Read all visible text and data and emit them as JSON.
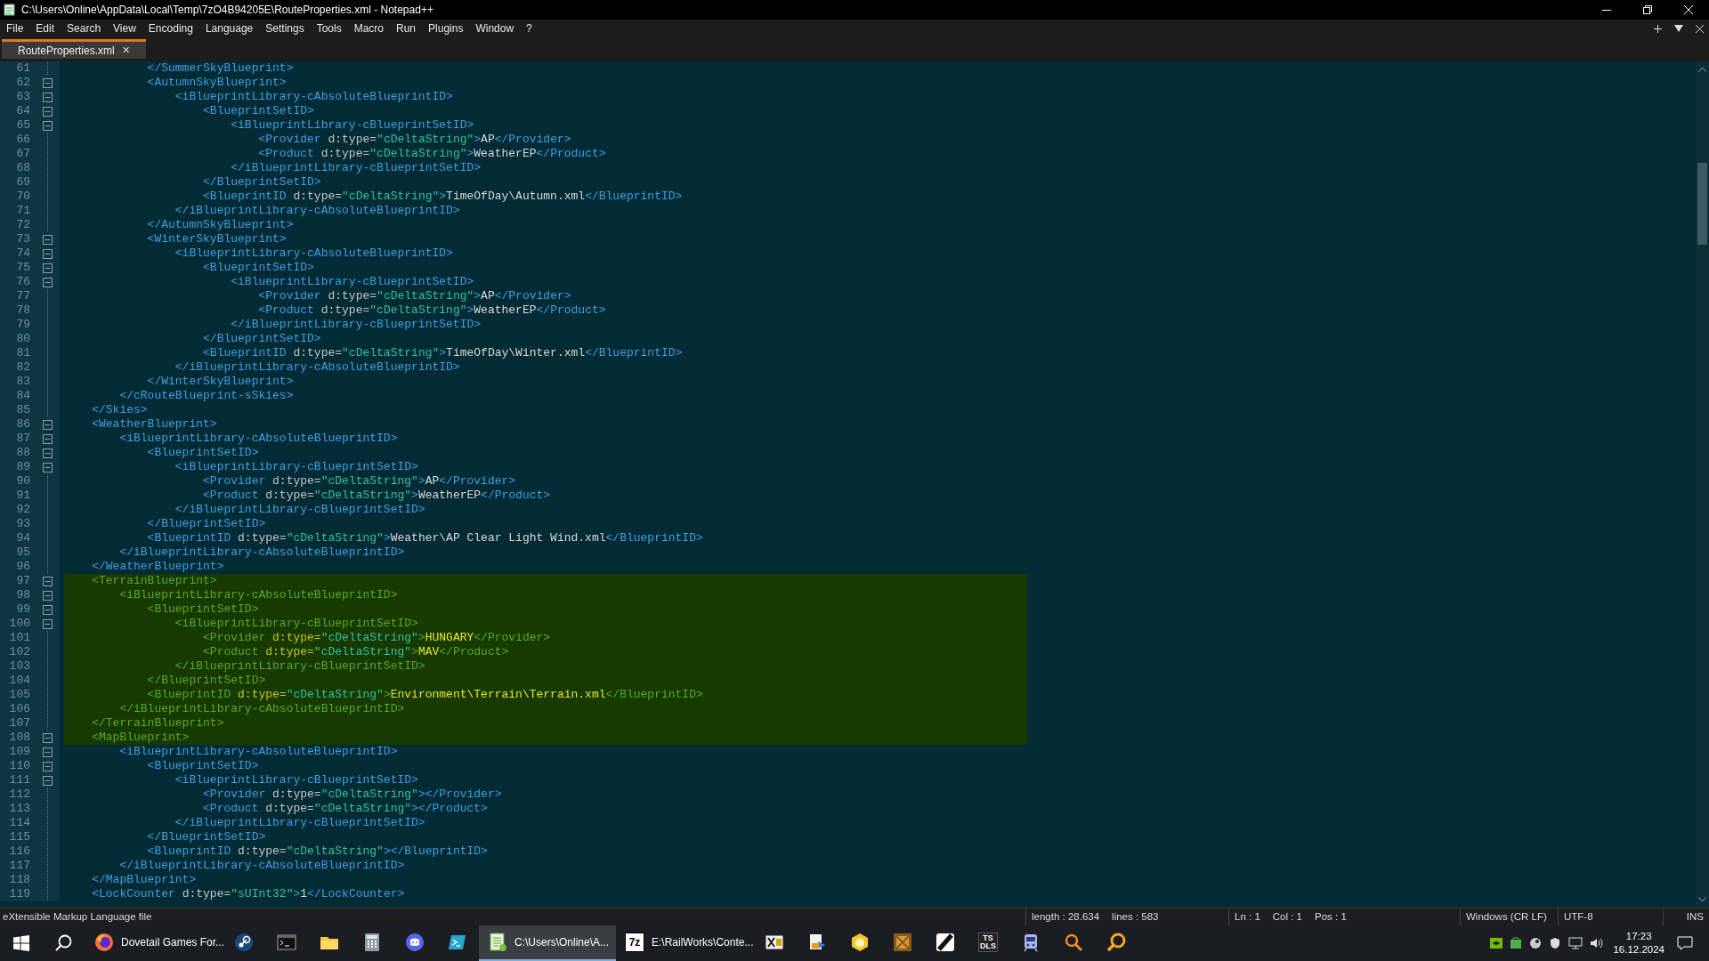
{
  "window": {
    "title": "C:\\Users\\Online\\AppData\\Local\\Temp\\7zO4B94205E\\RouteProperties.xml - Notepad++"
  },
  "menu": [
    "File",
    "Edit",
    "Search",
    "View",
    "Encoding",
    "Language",
    "Settings",
    "Tools",
    "Macro",
    "Run",
    "Plugins",
    "Window",
    "?"
  ],
  "tabs": [
    {
      "label": "RouteProperties.xml",
      "close": "✕",
      "selected": true
    }
  ],
  "editor": {
    "lines": [
      {
        "number": "61",
        "fold": false,
        "highlighted": false,
        "tokens": [
          {
            "kind": "tag",
            "text": "            </SummerSkyBlueprint>"
          }
        ]
      },
      {
        "number": "62",
        "fold": true,
        "highlighted": false,
        "tokens": [
          {
            "kind": "tag",
            "text": "            <AutumnSkyBlueprint>"
          }
        ]
      },
      {
        "number": "63",
        "fold": true,
        "highlighted": false,
        "tokens": [
          {
            "kind": "tag",
            "text": "                <iBlueprintLibrary-cAbsoluteBlueprintID>"
          }
        ]
      },
      {
        "number": "64",
        "fold": true,
        "highlighted": false,
        "tokens": [
          {
            "kind": "tag",
            "text": "                    <BlueprintSetID>"
          }
        ]
      },
      {
        "number": "65",
        "fold": true,
        "highlighted": false,
        "tokens": [
          {
            "kind": "tag",
            "text": "                        <iBlueprintLibrary-cBlueprintSetID>"
          }
        ]
      },
      {
        "number": "66",
        "fold": false,
        "highlighted": false,
        "tokens": [
          {
            "kind": "tag",
            "text": "                            <Provider"
          },
          {
            "kind": "attr",
            "text": " d:type="
          },
          {
            "kind": "value",
            "text": "\"cDeltaString\""
          },
          {
            "kind": "tag",
            "text": ">"
          },
          {
            "kind": "text",
            "text": "AP"
          },
          {
            "kind": "tag",
            "text": "</Provider>"
          }
        ]
      },
      {
        "number": "67",
        "fold": false,
        "highlighted": false,
        "tokens": [
          {
            "kind": "tag",
            "text": "                            <Product"
          },
          {
            "kind": "attr",
            "text": " d:type="
          },
          {
            "kind": "value",
            "text": "\"cDeltaString\""
          },
          {
            "kind": "tag",
            "text": ">"
          },
          {
            "kind": "text",
            "text": "WeatherEP"
          },
          {
            "kind": "tag",
            "text": "</Product>"
          }
        ]
      },
      {
        "number": "68",
        "fold": false,
        "highlighted": false,
        "tokens": [
          {
            "kind": "tag",
            "text": "                        </iBlueprintLibrary-cBlueprintSetID>"
          }
        ]
      },
      {
        "number": "69",
        "fold": false,
        "highlighted": false,
        "tokens": [
          {
            "kind": "tag",
            "text": "                    </BlueprintSetID>"
          }
        ]
      },
      {
        "number": "70",
        "fold": false,
        "highlighted": false,
        "tokens": [
          {
            "kind": "tag",
            "text": "                    <BlueprintID"
          },
          {
            "kind": "attr",
            "text": " d:type="
          },
          {
            "kind": "value",
            "text": "\"cDeltaString\""
          },
          {
            "kind": "tag",
            "text": ">"
          },
          {
            "kind": "text",
            "text": "TimeOfDay\\Autumn.xml"
          },
          {
            "kind": "tag",
            "text": "</BlueprintID>"
          }
        ]
      },
      {
        "number": "71",
        "fold": false,
        "highlighted": false,
        "tokens": [
          {
            "kind": "tag",
            "text": "                </iBlueprintLibrary-cAbsoluteBlueprintID>"
          }
        ]
      },
      {
        "number": "72",
        "fold": false,
        "highlighted": false,
        "tokens": [
          {
            "kind": "tag",
            "text": "            </AutumnSkyBlueprint>"
          }
        ]
      },
      {
        "number": "73",
        "fold": true,
        "highlighted": false,
        "tokens": [
          {
            "kind": "tag",
            "text": "            <WinterSkyBlueprint>"
          }
        ]
      },
      {
        "number": "74",
        "fold": true,
        "highlighted": false,
        "tokens": [
          {
            "kind": "tag",
            "text": "                <iBlueprintLibrary-cAbsoluteBlueprintID>"
          }
        ]
      },
      {
        "number": "75",
        "fold": true,
        "highlighted": false,
        "tokens": [
          {
            "kind": "tag",
            "text": "                    <BlueprintSetID>"
          }
        ]
      },
      {
        "number": "76",
        "fold": true,
        "highlighted": false,
        "tokens": [
          {
            "kind": "tag",
            "text": "                        <iBlueprintLibrary-cBlueprintSetID>"
          }
        ]
      },
      {
        "number": "77",
        "fold": false,
        "highlighted": false,
        "tokens": [
          {
            "kind": "tag",
            "text": "                            <Provider"
          },
          {
            "kind": "attr",
            "text": " d:type="
          },
          {
            "kind": "value",
            "text": "\"cDeltaString\""
          },
          {
            "kind": "tag",
            "text": ">"
          },
          {
            "kind": "text",
            "text": "AP"
          },
          {
            "kind": "tag",
            "text": "</Provider>"
          }
        ]
      },
      {
        "number": "78",
        "fold": false,
        "highlighted": false,
        "tokens": [
          {
            "kind": "tag",
            "text": "                            <Product"
          },
          {
            "kind": "attr",
            "text": " d:type="
          },
          {
            "kind": "value",
            "text": "\"cDeltaString\""
          },
          {
            "kind": "tag",
            "text": ">"
          },
          {
            "kind": "text",
            "text": "WeatherEP"
          },
          {
            "kind": "tag",
            "text": "</Product>"
          }
        ]
      },
      {
        "number": "79",
        "fold": false,
        "highlighted": false,
        "tokens": [
          {
            "kind": "tag",
            "text": "                        </iBlueprintLibrary-cBlueprintSetID>"
          }
        ]
      },
      {
        "number": "80",
        "fold": false,
        "highlighted": false,
        "tokens": [
          {
            "kind": "tag",
            "text": "                    </BlueprintSetID>"
          }
        ]
      },
      {
        "number": "81",
        "fold": false,
        "highlighted": false,
        "tokens": [
          {
            "kind": "tag",
            "text": "                    <BlueprintID"
          },
          {
            "kind": "attr",
            "text": " d:type="
          },
          {
            "kind": "value",
            "text": "\"cDeltaString\""
          },
          {
            "kind": "tag",
            "text": ">"
          },
          {
            "kind": "text",
            "text": "TimeOfDay\\Winter.xml"
          },
          {
            "kind": "tag",
            "text": "</BlueprintID>"
          }
        ]
      },
      {
        "number": "82",
        "fold": false,
        "highlighted": false,
        "tokens": [
          {
            "kind": "tag",
            "text": "                </iBlueprintLibrary-cAbsoluteBlueprintID>"
          }
        ]
      },
      {
        "number": "83",
        "fold": false,
        "highlighted": false,
        "tokens": [
          {
            "kind": "tag",
            "text": "            </WinterSkyBlueprint>"
          }
        ]
      },
      {
        "number": "84",
        "fold": false,
        "highlighted": false,
        "tokens": [
          {
            "kind": "tag",
            "text": "        </cRouteBlueprint-sSkies>"
          }
        ]
      },
      {
        "number": "85",
        "fold": false,
        "highlighted": false,
        "tokens": [
          {
            "kind": "tag",
            "text": "    </Skies>"
          }
        ]
      },
      {
        "number": "86",
        "fold": true,
        "highlighted": false,
        "tokens": [
          {
            "kind": "tag",
            "text": "    <WeatherBlueprint>"
          }
        ]
      },
      {
        "number": "87",
        "fold": true,
        "highlighted": false,
        "tokens": [
          {
            "kind": "tag",
            "text": "        <iBlueprintLibrary-cAbsoluteBlueprintID>"
          }
        ]
      },
      {
        "number": "88",
        "fold": true,
        "highlighted": false,
        "tokens": [
          {
            "kind": "tag",
            "text": "            <BlueprintSetID>"
          }
        ]
      },
      {
        "number": "89",
        "fold": true,
        "highlighted": false,
        "tokens": [
          {
            "kind": "tag",
            "text": "                <iBlueprintLibrary-cBlueprintSetID>"
          }
        ]
      },
      {
        "number": "90",
        "fold": false,
        "highlighted": false,
        "tokens": [
          {
            "kind": "tag",
            "text": "                    <Provider"
          },
          {
            "kind": "attr",
            "text": " d:type="
          },
          {
            "kind": "value",
            "text": "\"cDeltaString\""
          },
          {
            "kind": "tag",
            "text": ">"
          },
          {
            "kind": "text",
            "text": "AP"
          },
          {
            "kind": "tag",
            "text": "</Provider>"
          }
        ]
      },
      {
        "number": "91",
        "fold": false,
        "highlighted": false,
        "tokens": [
          {
            "kind": "tag",
            "text": "                    <Product"
          },
          {
            "kind": "attr",
            "text": " d:type="
          },
          {
            "kind": "value",
            "text": "\"cDeltaString\""
          },
          {
            "kind": "tag",
            "text": ">"
          },
          {
            "kind": "text",
            "text": "WeatherEP"
          },
          {
            "kind": "tag",
            "text": "</Product>"
          }
        ]
      },
      {
        "number": "92",
        "fold": false,
        "highlighted": false,
        "tokens": [
          {
            "kind": "tag",
            "text": "                </iBlueprintLibrary-cBlueprintSetID>"
          }
        ]
      },
      {
        "number": "93",
        "fold": false,
        "highlighted": false,
        "tokens": [
          {
            "kind": "tag",
            "text": "            </BlueprintSetID>"
          }
        ]
      },
      {
        "number": "94",
        "fold": false,
        "highlighted": false,
        "tokens": [
          {
            "kind": "tag",
            "text": "            <BlueprintID"
          },
          {
            "kind": "attr",
            "text": " d:type="
          },
          {
            "kind": "value",
            "text": "\"cDeltaString\""
          },
          {
            "kind": "tag",
            "text": ">"
          },
          {
            "kind": "text",
            "text": "Weather\\AP Clear Light Wind.xml"
          },
          {
            "kind": "tag",
            "text": "</BlueprintID>"
          }
        ]
      },
      {
        "number": "95",
        "fold": false,
        "highlighted": false,
        "tokens": [
          {
            "kind": "tag",
            "text": "        </iBlueprintLibrary-cAbsoluteBlueprintID>"
          }
        ]
      },
      {
        "number": "96",
        "fold": false,
        "highlighted": false,
        "tokens": [
          {
            "kind": "tag",
            "text": "    </WeatherBlueprint>"
          }
        ]
      },
      {
        "number": "97",
        "fold": true,
        "highlighted": true,
        "tokens": [
          {
            "kind": "tag",
            "text": "    <TerrainBlueprint>"
          }
        ]
      },
      {
        "number": "98",
        "fold": true,
        "highlighted": true,
        "tokens": [
          {
            "kind": "tag",
            "text": "        <iBlueprintLibrary-cAbsoluteBlueprintID>"
          }
        ]
      },
      {
        "number": "99",
        "fold": true,
        "highlighted": true,
        "tokens": [
          {
            "kind": "tag",
            "text": "            <BlueprintSetID>"
          }
        ]
      },
      {
        "number": "100",
        "fold": true,
        "highlighted": true,
        "tokens": [
          {
            "kind": "tag",
            "text": "                <iBlueprintLibrary-cBlueprintSetID>"
          }
        ]
      },
      {
        "number": "101",
        "fold": false,
        "highlighted": true,
        "tokens": [
          {
            "kind": "tag",
            "text": "                    <Provider"
          },
          {
            "kind": "attr",
            "text": " d:type="
          },
          {
            "kind": "value",
            "text": "\"cDeltaString\""
          },
          {
            "kind": "tag",
            "text": ">"
          },
          {
            "kind": "text",
            "text": "HUNGARY"
          },
          {
            "kind": "tag",
            "text": "</Provider>"
          }
        ]
      },
      {
        "number": "102",
        "fold": false,
        "highlighted": true,
        "tokens": [
          {
            "kind": "tag",
            "text": "                    <Product"
          },
          {
            "kind": "attr",
            "text": " d:type="
          },
          {
            "kind": "value",
            "text": "\"cDeltaString\""
          },
          {
            "kind": "tag",
            "text": ">"
          },
          {
            "kind": "text",
            "text": "MAV"
          },
          {
            "kind": "tag",
            "text": "</Product>"
          }
        ]
      },
      {
        "number": "103",
        "fold": false,
        "highlighted": true,
        "tokens": [
          {
            "kind": "tag",
            "text": "                </iBlueprintLibrary-cBlueprintSetID>"
          }
        ]
      },
      {
        "number": "104",
        "fold": false,
        "highlighted": true,
        "tokens": [
          {
            "kind": "tag",
            "text": "            </BlueprintSetID>"
          }
        ]
      },
      {
        "number": "105",
        "fold": false,
        "highlighted": true,
        "tokens": [
          {
            "kind": "tag",
            "text": "            <BlueprintID"
          },
          {
            "kind": "attr",
            "text": " d:type="
          },
          {
            "kind": "value",
            "text": "\"cDeltaString\""
          },
          {
            "kind": "tag",
            "text": ">"
          },
          {
            "kind": "text",
            "text": "Environment\\Terrain\\Terrain.xml"
          },
          {
            "kind": "tag",
            "text": "</BlueprintID>"
          }
        ]
      },
      {
        "number": "106",
        "fold": false,
        "highlighted": true,
        "tokens": [
          {
            "kind": "tag",
            "text": "        </iBlueprintLibrary-cAbsoluteBlueprintID>"
          }
        ]
      },
      {
        "number": "107",
        "fold": false,
        "highlighted": true,
        "tokens": [
          {
            "kind": "tag",
            "text": "    </TerrainBlueprint>"
          }
        ]
      },
      {
        "number": "108",
        "fold": true,
        "highlighted": true,
        "tokens": [
          {
            "kind": "tag",
            "text": "    <MapBlueprint>"
          }
        ]
      },
      {
        "number": "109",
        "fold": true,
        "highlighted": false,
        "tokens": [
          {
            "kind": "tag",
            "text": "        <iBlueprintLibrary-cAbsoluteBlueprintID>"
          }
        ]
      },
      {
        "number": "110",
        "fold": true,
        "highlighted": false,
        "tokens": [
          {
            "kind": "tag",
            "text": "            <BlueprintSetID>"
          }
        ]
      },
      {
        "number": "111",
        "fold": true,
        "highlighted": false,
        "tokens": [
          {
            "kind": "tag",
            "text": "                <iBlueprintLibrary-cBlueprintSetID>"
          }
        ]
      },
      {
        "number": "112",
        "fold": false,
        "highlighted": false,
        "tokens": [
          {
            "kind": "tag",
            "text": "                    <Provider"
          },
          {
            "kind": "attr",
            "text": " d:type="
          },
          {
            "kind": "value",
            "text": "\"cDeltaString\""
          },
          {
            "kind": "tag",
            "text": "></Provider>"
          }
        ]
      },
      {
        "number": "113",
        "fold": false,
        "highlighted": false,
        "tokens": [
          {
            "kind": "tag",
            "text": "                    <Product"
          },
          {
            "kind": "attr",
            "text": " d:type="
          },
          {
            "kind": "value",
            "text": "\"cDeltaString\""
          },
          {
            "kind": "tag",
            "text": "></Product>"
          }
        ]
      },
      {
        "number": "114",
        "fold": false,
        "highlighted": false,
        "tokens": [
          {
            "kind": "tag",
            "text": "                </iBlueprintLibrary-cBlueprintSetID>"
          }
        ]
      },
      {
        "number": "115",
        "fold": false,
        "highlighted": false,
        "tokens": [
          {
            "kind": "tag",
            "text": "            </BlueprintSetID>"
          }
        ]
      },
      {
        "number": "116",
        "fold": false,
        "highlighted": false,
        "tokens": [
          {
            "kind": "tag",
            "text": "            <BlueprintID"
          },
          {
            "kind": "attr",
            "text": " d:type="
          },
          {
            "kind": "value",
            "text": "\"cDeltaString\""
          },
          {
            "kind": "tag",
            "text": "></BlueprintID>"
          }
        ]
      },
      {
        "number": "117",
        "fold": false,
        "highlighted": false,
        "tokens": [
          {
            "kind": "tag",
            "text": "        </iBlueprintLibrary-cAbsoluteBlueprintID>"
          }
        ]
      },
      {
        "number": "118",
        "fold": false,
        "highlighted": false,
        "tokens": [
          {
            "kind": "tag",
            "text": "    </MapBlueprint>"
          }
        ]
      },
      {
        "number": "119",
        "fold": false,
        "highlighted": false,
        "tokens": [
          {
            "kind": "tag",
            "text": "    <LockCounter"
          },
          {
            "kind": "attr",
            "text": " d:type="
          },
          {
            "kind": "value",
            "text": "\"sUInt32\""
          },
          {
            "kind": "tag",
            "text": ">"
          },
          {
            "kind": "text",
            "text": "1"
          },
          {
            "kind": "tag",
            "text": "</LockCounter>"
          }
        ]
      }
    ]
  },
  "status_bar": {
    "file_type": "eXtensible Markup Language file",
    "length": "length : 28.634",
    "lines": "lines : 583",
    "ln": "Ln : 1",
    "col": "Col : 1",
    "pos": "Pos : 1",
    "eol": "Windows (CR LF)",
    "encoding": "UTF-8",
    "mode": "INS"
  },
  "taskbar": {
    "apps": [
      {
        "kind": "firefox",
        "label": "Dovetail Games For...",
        "selected": false
      },
      {
        "kind": "steam",
        "selected": false
      },
      {
        "kind": "terminal",
        "selected": false
      },
      {
        "kind": "folder",
        "selected": false
      },
      {
        "kind": "calculator",
        "selected": false
      },
      {
        "kind": "chat",
        "selected": false
      },
      {
        "kind": "shell",
        "selected": false
      },
      {
        "kind": "notepad",
        "label": "C:\\Users\\Online\\A...",
        "selected": true
      },
      {
        "kind": "archive",
        "badge": "7z",
        "label": "E:\\RailWorks\\Conte...",
        "selected": false
      },
      {
        "kind": "crossbox",
        "selected": false
      },
      {
        "kind": "document",
        "selected": false
      },
      {
        "kind": "hexagon",
        "selected": false
      },
      {
        "kind": "crate",
        "selected": false
      },
      {
        "kind": "slash",
        "selected": false
      },
      {
        "kind": "tile",
        "badge": "TS DLS",
        "selected": false
      },
      {
        "kind": "train",
        "selected": false
      },
      {
        "kind": "search",
        "selected": false
      },
      {
        "kind": "magnifier",
        "selected": false
      }
    ],
    "time": "17:23",
    "date": "16.12.2024"
  }
}
